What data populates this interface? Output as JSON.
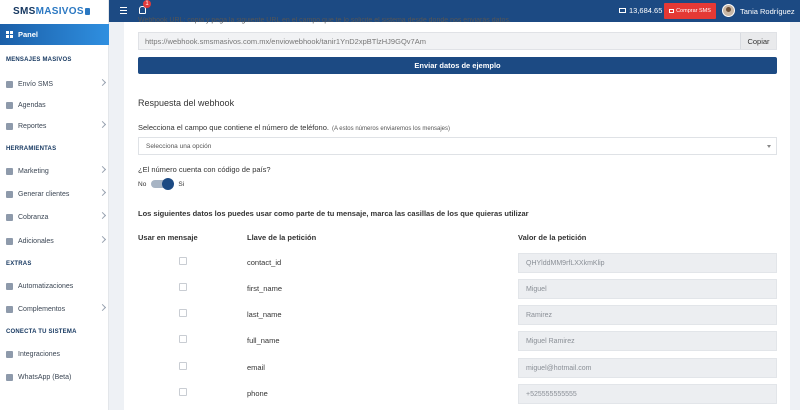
{
  "brand": {
    "part1": "SMS",
    "part2": "MASIVOS"
  },
  "sidebar": {
    "panel": "Panel",
    "sections": [
      {
        "title": "MENSAJES MASIVOS"
      },
      {
        "title": "HERRAMIENTAS"
      },
      {
        "title": "EXTRAS"
      },
      {
        "title": "CONECTA TU SISTEMA"
      }
    ],
    "items": [
      {
        "label": "Envío SMS",
        "icon": "chat-icon"
      },
      {
        "label": "Agendas",
        "icon": "address-book-icon"
      },
      {
        "label": "Reportes",
        "icon": "bar-chart-icon"
      },
      {
        "label": "Marketing",
        "icon": "chart-icon"
      },
      {
        "label": "Generar clientes",
        "icon": "funnel-icon"
      },
      {
        "label": "Cobranza",
        "icon": "money-icon"
      },
      {
        "label": "Adicionales",
        "icon": "chart-icon"
      },
      {
        "label": "Automatizaciones",
        "icon": "robot-icon"
      },
      {
        "label": "Complementos",
        "icon": "wrench-icon"
      },
      {
        "label": "Integraciones",
        "icon": "gear-icon"
      },
      {
        "label": "WhatsApp (Beta)",
        "icon": "whatsapp-icon"
      }
    ]
  },
  "topbar": {
    "notifications_count": "1",
    "balance": "13,684.65",
    "buy_label": "Comprar SMS",
    "user_name": "Tania Rodríguez"
  },
  "webhook": {
    "truncated_text": "Webhook URL: copia y pega la siguiente URL en el campo que te lo solicite el sistema desde donde nos enviarás datos.",
    "url": "https://webhook.smsmasivos.com.mx/enviowebhook/tanir1YnD2xpBTlzHJ9GQv7Am",
    "copy_label": "Copiar",
    "send_label": "Enviar datos de ejemplo",
    "response_title": "Respuesta del webhook",
    "phone_field_label": "Selecciona el campo que contiene el número de teléfono.",
    "phone_field_hint": "(A estos números enviaremos los mensajes)",
    "select_placeholder": "Selecciona una opción",
    "country_code_question": "¿El número cuenta con código de país?",
    "toggle_no": "No",
    "toggle_yes": "Si",
    "toggle_state": "yes",
    "data_title": "Los siguientes datos los puedes usar como parte de tu mensaje, marca las casillas de los que quieras utilizar"
  },
  "table": {
    "headers": [
      "Usar en mensaje",
      "Llave de la petición",
      "Valor de la petición"
    ],
    "rows": [
      {
        "key": "contact_id",
        "value": "QHYlddMM9rfLXXkmKlip"
      },
      {
        "key": "first_name",
        "value": "Miguel"
      },
      {
        "key": "last_name",
        "value": "Ramirez"
      },
      {
        "key": "full_name",
        "value": "Miguel Ramirez"
      },
      {
        "key": "email",
        "value": "miguel@hotmail.com"
      },
      {
        "key": "phone",
        "value": "+525555555555"
      }
    ]
  },
  "colors": {
    "primary": "#1c4a83",
    "accent": "#2f8fe0",
    "danger": "#e53935"
  }
}
